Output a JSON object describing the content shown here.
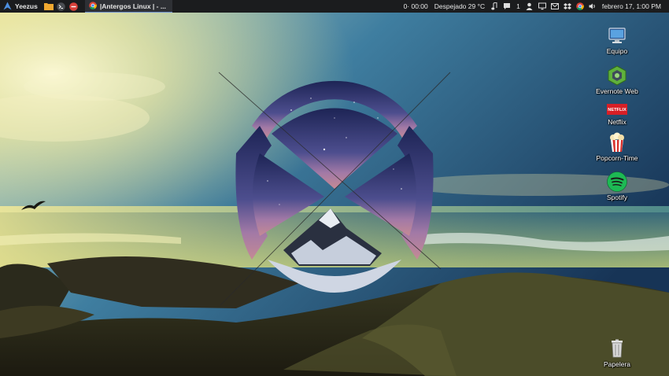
{
  "panel": {
    "menu_label": "Yeezus",
    "launchers": [
      {
        "icon": "folder-icon"
      },
      {
        "icon": "terminal-icon"
      },
      {
        "icon": "power-icon"
      }
    ],
    "task": {
      "icon": "chrome-icon",
      "label": "|Antergos Linux | - ..."
    },
    "tray": {
      "timer": "0· 00:00",
      "weather": "Despejado 29 °C",
      "music_icon": "music-note-icon",
      "chat_count": "1",
      "clock": "febrero 17, 1:00 PM"
    }
  },
  "desktop": {
    "icons": [
      {
        "label": "Equipo",
        "icon": "computer-icon"
      },
      {
        "label": "Evernote Web",
        "icon": "evernote-icon"
      },
      {
        "label": "Netflix",
        "icon": "netflix-icon",
        "badge": "NETFLIX"
      },
      {
        "label": "Popcorn-Time",
        "icon": "popcorn-icon"
      },
      {
        "label": "Spotify",
        "icon": "spotify-icon"
      },
      {
        "label": "Papelera",
        "icon": "trash-icon"
      }
    ]
  },
  "colors": {
    "panel_bg": "#1b1c1e",
    "task_bg": "#2e3035",
    "sky_top": "#1f3f66",
    "sun_glow": "#f3efb4",
    "sea": "#2f6378",
    "spotify_green": "#1db954",
    "netflix_red": "#d81f26"
  }
}
